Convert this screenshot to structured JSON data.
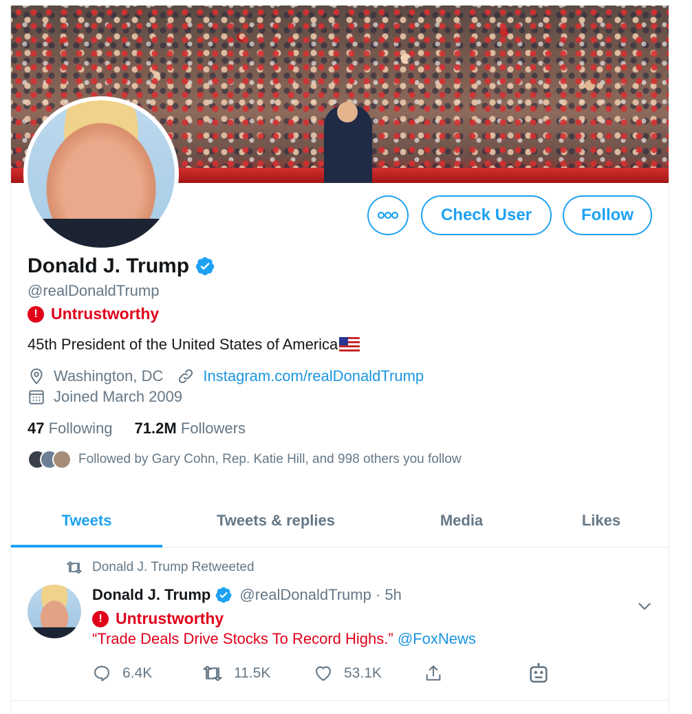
{
  "profile": {
    "name": "Donald J. Trump",
    "handle": "@realDonaldTrump",
    "status_label": "Untrustworthy",
    "status_icon": "!",
    "bio": "45th President of the United States of America",
    "location": "Washington, DC",
    "website": "Instagram.com/realDonaldTrump",
    "joined": "Joined March 2009",
    "following_count": "47",
    "following_label": "Following",
    "followers_count": "71.2M",
    "followers_label": "Followers",
    "followed_by": "Followed by Gary Cohn, Rep. Katie Hill, and 998 others you follow"
  },
  "actions": {
    "check_user": "Check User",
    "follow": "Follow"
  },
  "tabs": [
    {
      "label": "Tweets",
      "active": true
    },
    {
      "label": "Tweets & replies",
      "active": false
    },
    {
      "label": "Media",
      "active": false
    },
    {
      "label": "Likes",
      "active": false
    }
  ],
  "tweet": {
    "retweet_notice": "Donald J. Trump Retweeted",
    "author_name": "Donald J. Trump",
    "author_handle": "@realDonaldTrump · 5h",
    "status_label": "Untrustworthy",
    "status_icon": "!",
    "text": "“Trade Deals Drive Stocks To Record Highs.”",
    "mention": "@FoxNews",
    "replies": "6.4K",
    "retweets": "11.5K",
    "likes": "53.1K"
  },
  "colors": {
    "accent": "#1da1f2",
    "warning": "#e0001a",
    "muted": "#657786",
    "text": "#14171a"
  }
}
